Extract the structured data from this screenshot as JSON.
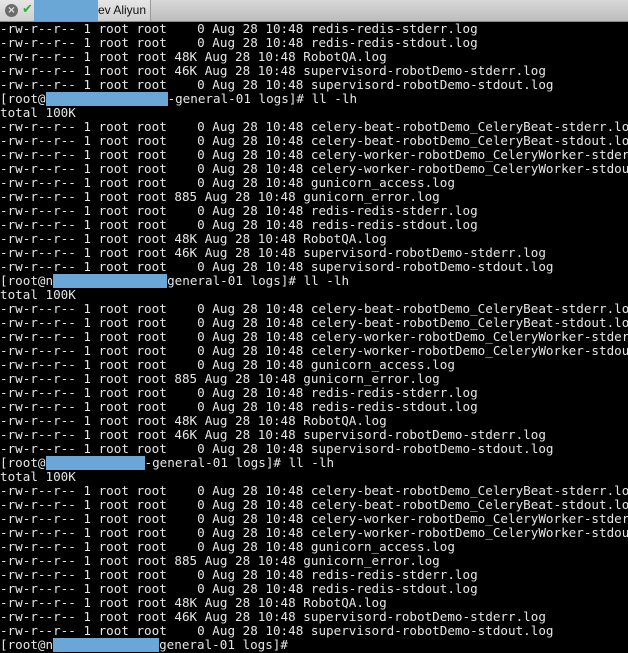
{
  "tab": {
    "title": "ev Aliyun",
    "close_glyph": "×",
    "status_glyph": "✔",
    "status_color": "#2fae3a",
    "redaction_color": "#6aa6d6"
  },
  "terminal": {
    "background": "#000000",
    "foreground": "#e6e6e6",
    "lines": [
      {
        "kind": "text",
        "text": "-rw-r--r-- 1 root root    0 Aug 28 10:48 redis-redis-stderr.log"
      },
      {
        "kind": "text",
        "text": "-rw-r--r-- 1 root root    0 Aug 28 10:48 redis-redis-stdout.log"
      },
      {
        "kind": "text",
        "text": "-rw-r--r-- 1 root root 48K Aug 28 10:48 RobotQA.log"
      },
      {
        "kind": "text",
        "text": "-rw-r--r-- 1 root root 46K Aug 28 10:48 supervisord-robotDemo-stderr.log"
      },
      {
        "kind": "text",
        "text": "-rw-r--r-- 1 root root    0 Aug 28 10:48 supervisord-robotDemo-stdout.log"
      },
      {
        "kind": "prompt",
        "before": "[root@",
        "mid": "-general-01 logs]# ",
        "command": "ll -lh",
        "redact_chars": 16
      },
      {
        "kind": "text",
        "text": "total 100K"
      },
      {
        "kind": "text",
        "text": "-rw-r--r-- 1 root root    0 Aug 28 10:48 celery-beat-robotDemo_CeleryBeat-stderr.log"
      },
      {
        "kind": "text",
        "text": "-rw-r--r-- 1 root root    0 Aug 28 10:48 celery-beat-robotDemo_CeleryBeat-stdout.log"
      },
      {
        "kind": "text",
        "text": "-rw-r--r-- 1 root root    0 Aug 28 10:48 celery-worker-robotDemo_CeleryWorker-stderr.log"
      },
      {
        "kind": "text",
        "text": "-rw-r--r-- 1 root root    0 Aug 28 10:48 celery-worker-robotDemo_CeleryWorker-stdout.log"
      },
      {
        "kind": "text",
        "text": "-rw-r--r-- 1 root root    0 Aug 28 10:48 gunicorn_access.log"
      },
      {
        "kind": "text",
        "text": "-rw-r--r-- 1 root root 885 Aug 28 10:48 gunicorn_error.log"
      },
      {
        "kind": "text",
        "text": "-rw-r--r-- 1 root root    0 Aug 28 10:48 redis-redis-stderr.log"
      },
      {
        "kind": "text",
        "text": "-rw-r--r-- 1 root root    0 Aug 28 10:48 redis-redis-stdout.log"
      },
      {
        "kind": "text",
        "text": "-rw-r--r-- 1 root root 48K Aug 28 10:48 RobotQA.log"
      },
      {
        "kind": "text",
        "text": "-rw-r--r-- 1 root root 46K Aug 28 10:48 supervisord-robotDemo-stderr.log"
      },
      {
        "kind": "text",
        "text": "-rw-r--r-- 1 root root    0 Aug 28 10:48 supervisord-robotDemo-stdout.log"
      },
      {
        "kind": "prompt",
        "before": "[root@n",
        "mid": "general-01 logs]# ",
        "command": "ll -lh",
        "redact_chars": 15
      },
      {
        "kind": "text",
        "text": "total 100K"
      },
      {
        "kind": "text",
        "text": "-rw-r--r-- 1 root root    0 Aug 28 10:48 celery-beat-robotDemo_CeleryBeat-stderr.log"
      },
      {
        "kind": "text",
        "text": "-rw-r--r-- 1 root root    0 Aug 28 10:48 celery-beat-robotDemo_CeleryBeat-stdout.log"
      },
      {
        "kind": "text",
        "text": "-rw-r--r-- 1 root root    0 Aug 28 10:48 celery-worker-robotDemo_CeleryWorker-stderr.log"
      },
      {
        "kind": "text",
        "text": "-rw-r--r-- 1 root root    0 Aug 28 10:48 celery-worker-robotDemo_CeleryWorker-stdout.log"
      },
      {
        "kind": "text",
        "text": "-rw-r--r-- 1 root root    0 Aug 28 10:48 gunicorn_access.log"
      },
      {
        "kind": "text",
        "text": "-rw-r--r-- 1 root root 885 Aug 28 10:48 gunicorn_error.log"
      },
      {
        "kind": "text",
        "text": "-rw-r--r-- 1 root root    0 Aug 28 10:48 redis-redis-stderr.log"
      },
      {
        "kind": "text",
        "text": "-rw-r--r-- 1 root root    0 Aug 28 10:48 redis-redis-stdout.log"
      },
      {
        "kind": "text",
        "text": "-rw-r--r-- 1 root root 48K Aug 28 10:48 RobotQA.log"
      },
      {
        "kind": "text",
        "text": "-rw-r--r-- 1 root root 46K Aug 28 10:48 supervisord-robotDemo-stderr.log"
      },
      {
        "kind": "text",
        "text": "-rw-r--r-- 1 root root    0 Aug 28 10:48 supervisord-robotDemo-stdout.log"
      },
      {
        "kind": "prompt",
        "before": "[root@",
        "mid": "-general-01 logs]# ",
        "command": "ll -lh",
        "redact_chars": 13
      },
      {
        "kind": "text",
        "text": "total 100K"
      },
      {
        "kind": "text",
        "text": "-rw-r--r-- 1 root root    0 Aug 28 10:48 celery-beat-robotDemo_CeleryBeat-stderr.log"
      },
      {
        "kind": "text",
        "text": "-rw-r--r-- 1 root root    0 Aug 28 10:48 celery-beat-robotDemo_CeleryBeat-stdout.log"
      },
      {
        "kind": "text",
        "text": "-rw-r--r-- 1 root root    0 Aug 28 10:48 celery-worker-robotDemo_CeleryWorker-stderr.log"
      },
      {
        "kind": "text",
        "text": "-rw-r--r-- 1 root root    0 Aug 28 10:48 celery-worker-robotDemo_CeleryWorker-stdout.log"
      },
      {
        "kind": "text",
        "text": "-rw-r--r-- 1 root root    0 Aug 28 10:48 gunicorn_access.log"
      },
      {
        "kind": "text",
        "text": "-rw-r--r-- 1 root root 885 Aug 28 10:48 gunicorn_error.log"
      },
      {
        "kind": "text",
        "text": "-rw-r--r-- 1 root root    0 Aug 28 10:48 redis-redis-stderr.log"
      },
      {
        "kind": "text",
        "text": "-rw-r--r-- 1 root root    0 Aug 28 10:48 redis-redis-stdout.log"
      },
      {
        "kind": "text",
        "text": "-rw-r--r-- 1 root root 48K Aug 28 10:48 RobotQA.log"
      },
      {
        "kind": "text",
        "text": "-rw-r--r-- 1 root root 46K Aug 28 10:48 supervisord-robotDemo-stderr.log"
      },
      {
        "kind": "text",
        "text": "-rw-r--r-- 1 root root    0 Aug 28 10:48 supervisord-robotDemo-stdout.log"
      },
      {
        "kind": "prompt",
        "before": "[root@n",
        "mid": "general-01 logs]# ",
        "command": "",
        "redact_chars": 14
      }
    ]
  }
}
